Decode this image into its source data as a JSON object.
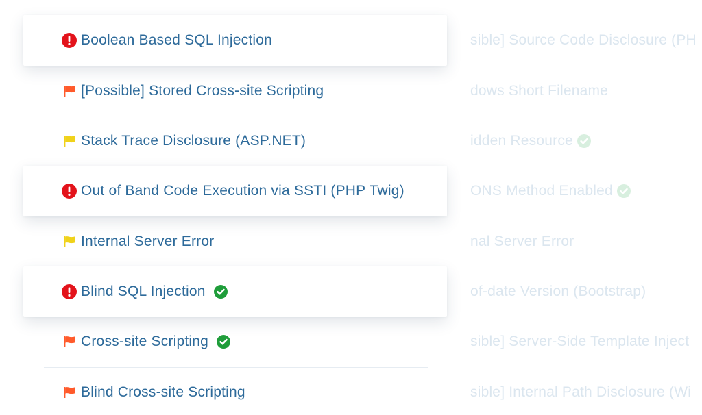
{
  "colors": {
    "critical": "#e3131b",
    "high": "#ff5a2b",
    "medium": "#f0d21a",
    "verified": "#1f9d3a",
    "label": "#2d6a9a",
    "faded_label": "#dbe6ef",
    "faded_verified": "#d8efdf"
  },
  "vulnerabilities": [
    {
      "label": "Boolean Based SQL Injection",
      "severity_icon": "critical-exclamation-icon",
      "verified": false
    },
    {
      "label": "[Possible] Stored Cross-site Scripting",
      "severity_icon": "orange-flag-icon",
      "verified": false
    },
    {
      "label": "Stack Trace Disclosure (ASP.NET)",
      "severity_icon": "yellow-flag-icon",
      "verified": false
    },
    {
      "label": "Out of Band Code Execution via SSTI (PHP Twig)",
      "severity_icon": "critical-exclamation-icon",
      "verified": false
    },
    {
      "label": "Internal Server Error",
      "severity_icon": "yellow-flag-icon",
      "verified": false
    },
    {
      "label": "Blind SQL Injection",
      "severity_icon": "critical-exclamation-icon",
      "verified": true
    },
    {
      "label": "Cross-site Scripting",
      "severity_icon": "orange-flag-icon",
      "verified": true
    },
    {
      "label": "Blind Cross-site Scripting",
      "severity_icon": "orange-flag-icon",
      "verified": false
    }
  ],
  "background_list": [
    {
      "label": "sible] Source Code Disclosure (PH",
      "verified": false
    },
    {
      "label": "dows Short Filename",
      "verified": false
    },
    {
      "label": "idden Resource",
      "verified": true
    },
    {
      "label": "ONS Method Enabled",
      "verified": true
    },
    {
      "label": "nal Server Error",
      "verified": false
    },
    {
      "label": "of-date Version (Bootstrap)",
      "verified": false
    },
    {
      "label": "sible] Server-Side Template Inject",
      "verified": false
    },
    {
      "label": "sible] Internal Path Disclosure (Wi",
      "verified": false
    }
  ]
}
